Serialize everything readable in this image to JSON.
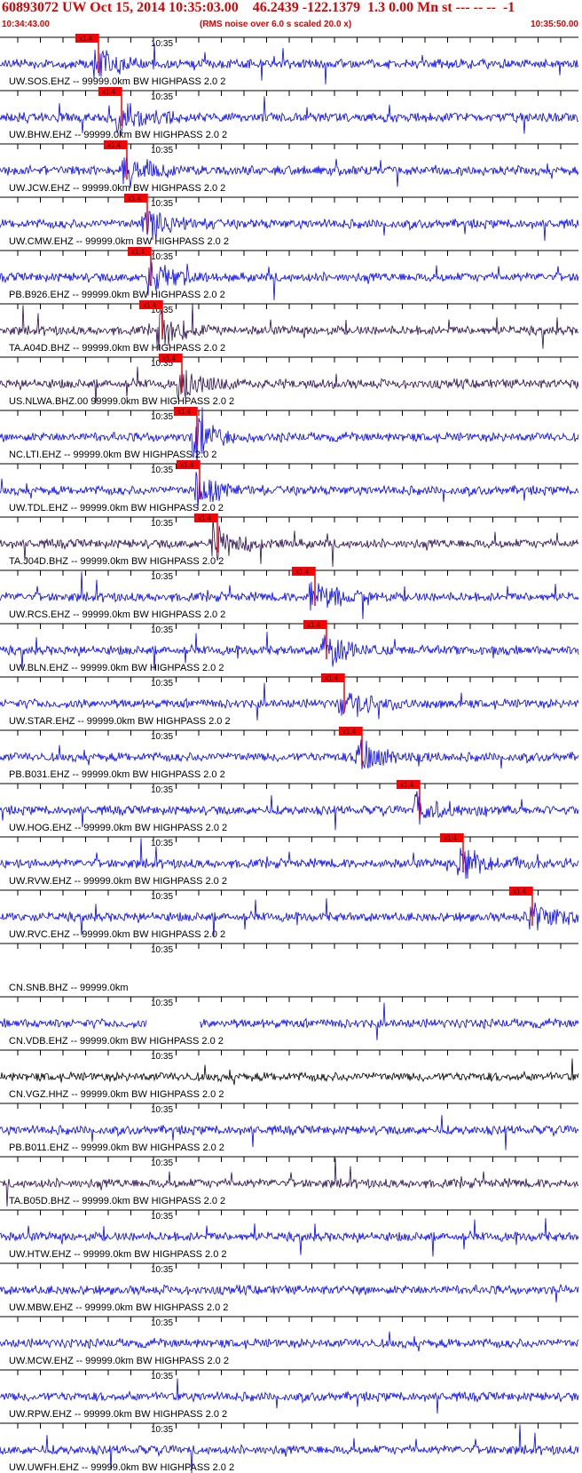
{
  "header": {
    "title": "60893072 UW Oct 15, 2014 10:35:03.00    46.2439 -122.1379  1.3 0.00 Mn st --- -- --  -1",
    "start_time": "10:34:43.00",
    "note": "(RMS noise over 6.0 s scaled 20.0 x)",
    "end_time": "10:35:50.00"
  },
  "colors": {
    "trace": "#0000ff",
    "trace_dark": "#2a0a50",
    "trace_black": "#000000",
    "pick": "#ff0000",
    "header_text": "#e00000",
    "axis": "#000000"
  },
  "chart_data": {
    "type": "line",
    "title": "60893072 UW Oct 15, 2014 10:35:03.00    46.2439 -122.1379  1.3 0.00 Mn st --- -- --  -1",
    "x_range": [
      "10:34:43.00",
      "10:35:50.00"
    ],
    "x_tick_label": "10:35",
    "pick_label": "x1.4",
    "traces": [
      {
        "label": "UW.SOS.EHZ -- 99999.0km BW  HIGHPASS  2.0  2",
        "color": "blue",
        "pick": true
      },
      {
        "label": "UW.BHW.EHZ -- 99999.0km BW  HIGHPASS  2.0  2",
        "color": "blue",
        "pick": true
      },
      {
        "label": "UW.JCW.EHZ -- 99999.0km BW  HIGHPASS  2.0  2",
        "color": "blue",
        "pick": true
      },
      {
        "label": "UW.CMW.EHZ -- 99999.0km BW  HIGHPASS  2.0  2",
        "color": "blue",
        "pick": true
      },
      {
        "label": "PB.B926.EHZ -- 99999.0km BW  HIGHPASS  2.0  2",
        "color": "blue",
        "pick": true
      },
      {
        "label": "TA.A04D.BHZ -- 99999.0km BW  HIGHPASS  2.0  2",
        "color": "dark",
        "pick": true
      },
      {
        "label": "US.NLWA.BHZ.00 99999.0km BW  HIGHPASS  2.0  2",
        "color": "dark",
        "pick": true
      },
      {
        "label": "NC.LTI.EHZ -- 99999.0km BW  HIGHPASS  2.0  2",
        "color": "blue",
        "pick": true
      },
      {
        "label": "UW.TDL.EHZ -- 99999.0km BW  HIGHPASS  2.0  2",
        "color": "blue",
        "pick": true
      },
      {
        "label": "TA.J04D.BHZ -- 99999.0km BW  HIGHPASS  2.0  2",
        "color": "dark",
        "pick": true
      },
      {
        "label": "UW.RCS.EHZ -- 99999.0km BW  HIGHPASS  2.0  2",
        "color": "blue",
        "pick": true
      },
      {
        "label": "UW.BLN.EHZ -- 99999.0km BW  HIGHPASS  2.0  2",
        "color": "blue",
        "pick": true
      },
      {
        "label": "UW.STAR.EHZ -- 99999.0km BW  HIGHPASS  2.0  2",
        "color": "blue",
        "pick": true
      },
      {
        "label": "PB.B031.EHZ -- 99999.0km BW  HIGHPASS  2.0  2",
        "color": "blue",
        "pick": true
      },
      {
        "label": "UW.HOG.EHZ -- 99999.0km BW  HIGHPASS  2.0  2",
        "color": "blue",
        "pick": true
      },
      {
        "label": "UW.RVW.EHZ -- 99999.0km BW  HIGHPASS  2.0  2",
        "color": "blue",
        "pick": true
      },
      {
        "label": "UW.RVC.EHZ -- 99999.0km BW  HIGHPASS  2.0  2",
        "color": "blue",
        "pick": true
      },
      {
        "label": "CN.SNB.BHZ -- 99999.0km",
        "color": "none",
        "pick": false
      },
      {
        "label": "CN.VDB.EHZ -- 99999.0km BW  HIGHPASS  2.0  2",
        "color": "blue",
        "pick": false
      },
      {
        "label": "CN.VGZ.HHZ -- 99999.0km BW  HIGHPASS  2.0  2",
        "color": "black",
        "pick": false
      },
      {
        "label": "PB.B011.EHZ -- 99999.0km BW  HIGHPASS  2.0  2",
        "color": "blue",
        "pick": false
      },
      {
        "label": "TA.B05D.BHZ -- 99999.0km BW  HIGHPASS  2.0  2",
        "color": "dark",
        "pick": false
      },
      {
        "label": "UW.HTW.EHZ -- 99999.0km BW  HIGHPASS  2.0  2",
        "color": "blue",
        "pick": false
      },
      {
        "label": "UW.MBW.EHZ -- 99999.0km BW  HIGHPASS  2.0  2",
        "color": "blue",
        "pick": false
      },
      {
        "label": "UW.MCW.EHZ -- 99999.0km BW  HIGHPASS  2.0  2",
        "color": "blue",
        "pick": false
      },
      {
        "label": "UW.RPW.EHZ -- 99999.0km BW  HIGHPASS  2.0  2",
        "color": "blue",
        "pick": false
      },
      {
        "label": "UW.UWFH.EHZ -- 99999.0km BW  HIGHPASS  2.0  2",
        "color": "blue",
        "pick": false
      }
    ]
  }
}
